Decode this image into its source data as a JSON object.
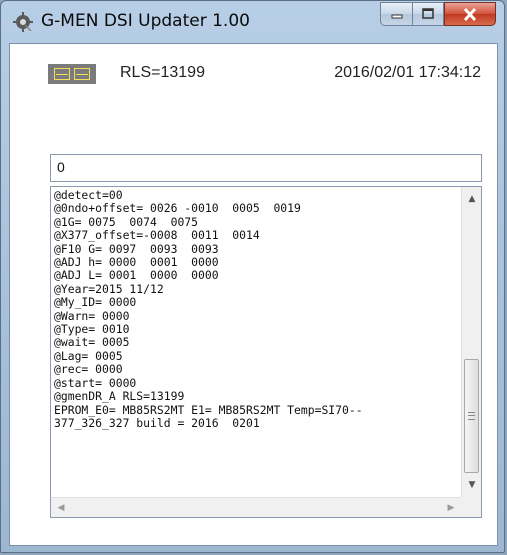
{
  "window": {
    "title": "G-MEN DSI Updater 1.00",
    "icons": {
      "app": "gear-app-icon",
      "minimize": "minimize-icon",
      "maximize": "maximize-icon",
      "close": "close-icon"
    }
  },
  "status": {
    "indicator_icon": "dual-segment-indicator-icon",
    "rls": "RLS=13199",
    "datetime": "2016/02/01 17:34:12"
  },
  "command_input": {
    "value": "0"
  },
  "log": {
    "lines": [
      "@detect=00",
      "@0ndo+offset= 0026 -0010  0005  0019",
      "@1G= 0075  0074  0075",
      "@X377_offset=-0008  0011  0014",
      "@F10 G= 0097  0093  0093",
      "@ADJ h= 0000  0001  0000",
      "@ADJ L= 0001  0000  0000",
      "@Year=2015 11/12",
      "@My_ID= 0000",
      "@Warn= 0000",
      "@Type= 0010",
      "@wait= 0005",
      "@Lag= 0005",
      "@rec= 0000",
      "@start= 0000",
      "@gmenDR_A RLS=13199",
      "EPROM_E0= MB85RS2MT E1= MB85RS2MT Temp=SI70--",
      "377_326_327 build = 2016  0201"
    ]
  },
  "colors": {
    "close_button": "#c03a22",
    "indicator_bg": "#7b7b7b",
    "indicator_segments": "#f2de5a",
    "frame": "#a6bfdb"
  }
}
